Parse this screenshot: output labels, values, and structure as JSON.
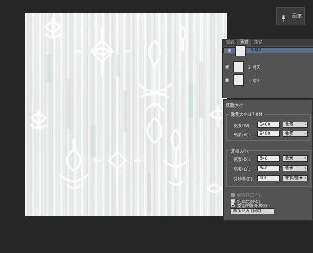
{
  "brush_chip": {
    "label": "画笔",
    "icon": "brush-icon"
  },
  "channels_panel": {
    "tabs": [
      "图层",
      "通道",
      "路径"
    ],
    "active_tab": 1,
    "rows": [
      {
        "name": "1 拷贝",
        "shortcut": "",
        "selected": true
      },
      {
        "name": "2 拷贝",
        "shortcut": "",
        "selected": false
      },
      {
        "name": "3 拷贝",
        "shortcut": "",
        "selected": false
      }
    ]
  },
  "image_size_dialog": {
    "title": "图像大小",
    "pixel_dimensions": {
      "label": "像素大小:27.8M",
      "width_label": "宽度(W):",
      "width_value": "5400",
      "width_unit": "像素",
      "height_label": "高度(H):",
      "height_value": "5400",
      "height_unit": "像素"
    },
    "document_size": {
      "label": "文档大小:",
      "width_label": "宽度(D):",
      "width_value": "540",
      "width_unit": "毫米",
      "height_label": "高度(G):",
      "height_value": "540",
      "height_unit": "毫米",
      "resolution_label": "分辨率(R):",
      "resolution_value": "100",
      "resolution_unit": "像素/厘米"
    },
    "options": {
      "scale_styles": "缩放样式(Y)",
      "constrain_proportions": "约束比例(C)",
      "resample": "重定图像像素(I):",
      "resample_method": "两次立方 (自动)"
    }
  }
}
